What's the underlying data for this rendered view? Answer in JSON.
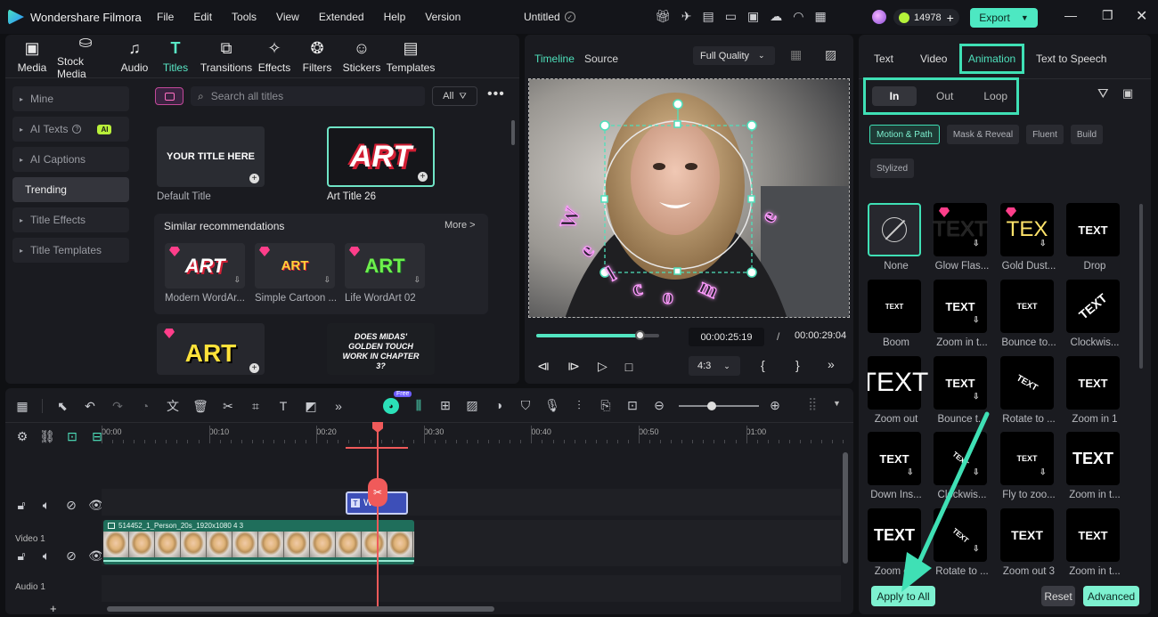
{
  "app": {
    "name": "Wondershare Filmora",
    "project": "Untitled",
    "credits": "14978",
    "export": "Export"
  },
  "menu": [
    "File",
    "Edit",
    "Tools",
    "View",
    "Extended",
    "Help",
    "Version"
  ],
  "media_tabs": [
    {
      "label": "Media",
      "icon": "media-icon"
    },
    {
      "label": "Stock Media",
      "icon": "stock-media-icon"
    },
    {
      "label": "Audio",
      "icon": "audio-icon"
    },
    {
      "label": "Titles",
      "icon": "titles-icon"
    },
    {
      "label": "Transitions",
      "icon": "transitions-icon"
    },
    {
      "label": "Effects",
      "icon": "effects-icon"
    },
    {
      "label": "Filters",
      "icon": "filters-icon"
    },
    {
      "label": "Stickers",
      "icon": "stickers-icon"
    },
    {
      "label": "Templates",
      "icon": "templates-icon"
    }
  ],
  "sidebar": [
    "Mine",
    "AI Texts",
    "AI Captions",
    "Trending",
    "Title Effects",
    "Title Templates"
  ],
  "sidebar_badge": "AI",
  "search": {
    "placeholder": "Search all titles",
    "filter": "All"
  },
  "titles": {
    "default": {
      "label": "Default Title",
      "text": "YOUR TITLE HERE"
    },
    "art26": {
      "label": "Art Title 26",
      "text": "ART"
    },
    "similar_heading": "Similar recommendations",
    "more": "More >",
    "similar": [
      {
        "label": "Modern WordAr...",
        "text": "ART"
      },
      {
        "label": "Simple Cartoon ...",
        "text": "ART"
      },
      {
        "label": "Life WordArt 02",
        "text": "ART"
      }
    ],
    "bottom": [
      {
        "text": "ART"
      },
      {
        "text": "DOES MIDAS' GOLDEN TOUCH WORK IN CHAPTER 3?"
      }
    ]
  },
  "player": {
    "tabs": [
      "Timeline",
      "Source"
    ],
    "quality": "Full Quality",
    "current": "00:00:25:19",
    "total": "00:00:29:04",
    "ratio": "4:3",
    "progress": 0.85,
    "overlay_text": "welcome"
  },
  "props": {
    "tabs": [
      "Text",
      "Video",
      "Animation",
      "Text to Speech"
    ],
    "sub_tabs": [
      "In",
      "Out",
      "Loop"
    ],
    "chips": [
      "Motion & Path",
      "Mask & Reveal",
      "Fluent",
      "Build",
      "Stylized"
    ],
    "animations": [
      {
        "label": "None",
        "tile": ""
      },
      {
        "label": "Glow Flas...",
        "tile": "TEXT"
      },
      {
        "label": "Gold Dust...",
        "tile": "TEX"
      },
      {
        "label": "Drop",
        "tile": "TEXT"
      },
      {
        "label": "Boom",
        "tile": "TEXT"
      },
      {
        "label": "Zoom in t...",
        "tile": "TEXT"
      },
      {
        "label": "Bounce to...",
        "tile": "TEXT"
      },
      {
        "label": "Clockwis...",
        "tile": "TEXT"
      },
      {
        "label": "Zoom out",
        "tile": "TEXT"
      },
      {
        "label": "Bounce t...",
        "tile": "TEXT"
      },
      {
        "label": "Rotate to ...",
        "tile": "TEXT"
      },
      {
        "label": "Zoom in 1",
        "tile": "TEXT"
      },
      {
        "label": "Down Ins...",
        "tile": "TEXT"
      },
      {
        "label": "Clockwis...",
        "tile": "TEXT"
      },
      {
        "label": "Fly to zoo...",
        "tile": "TEXT"
      },
      {
        "label": "Zoom in t...",
        "tile": "TEXT"
      },
      {
        "label": "Zoom o...",
        "tile": "TEXT"
      },
      {
        "label": "Rotate to ...",
        "tile": "TEXT"
      },
      {
        "label": "Zoom out 3",
        "tile": "TEXT"
      },
      {
        "label": "Zoom in t...",
        "tile": "TEXT"
      }
    ],
    "apply_all": "Apply to All",
    "reset": "Reset",
    "advanced": "Advanced"
  },
  "timeline": {
    "ruler": [
      "00:00",
      "00:10",
      "00:20",
      "00:30",
      "00:40",
      "00:50",
      "01:00"
    ],
    "video_label": "Video 1",
    "audio_label": "Audio 1",
    "clip_name": "514452_1_Person_20s_1920x1080 4 3",
    "title_clip": "W",
    "free_badge": "Free"
  },
  "colors": {
    "accent": "#7df1d0",
    "highlight": "#3fe0b5",
    "pink": "#ff3e8a",
    "clip": "#1f6e5b",
    "title_clip": "#3d4fb8"
  }
}
